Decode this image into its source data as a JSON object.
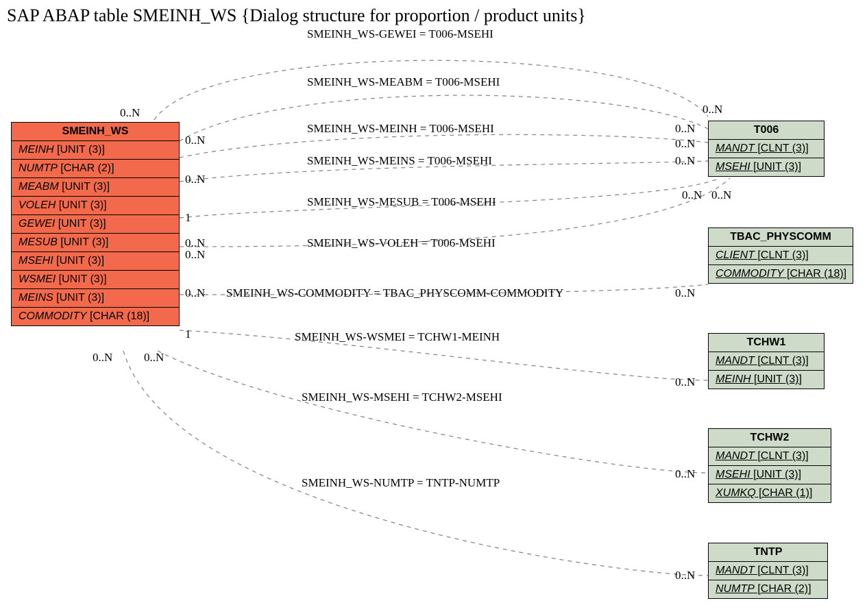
{
  "title": "SAP ABAP table SMEINH_WS {Dialog structure for proportion / product units}",
  "entities": {
    "smeinh_ws": {
      "name": "SMEINH_WS",
      "rows": [
        {
          "f": "MEINH",
          "t": " [UNIT (3)]"
        },
        {
          "f": "NUMTP",
          "t": " [CHAR (2)]"
        },
        {
          "f": "MEABM",
          "t": " [UNIT (3)]"
        },
        {
          "f": "VOLEH",
          "t": " [UNIT (3)]"
        },
        {
          "f": "GEWEI",
          "t": " [UNIT (3)]"
        },
        {
          "f": "MESUB",
          "t": " [UNIT (3)]"
        },
        {
          "f": "MSEHI",
          "t": " [UNIT (3)]"
        },
        {
          "f": "WSMEI",
          "t": " [UNIT (3)]"
        },
        {
          "f": "MEINS",
          "t": " [UNIT (3)]"
        },
        {
          "f": "COMMODITY",
          "t": " [CHAR (18)]"
        }
      ]
    },
    "t006": {
      "name": "T006",
      "rows": [
        {
          "f": "MANDT",
          "t": " [CLNT (3)]",
          "ul": true
        },
        {
          "f": "MSEHI",
          "t": " [UNIT (3)]",
          "ul": true
        }
      ]
    },
    "tbac": {
      "name": "TBAC_PHYSCOMM",
      "rows": [
        {
          "f": "CLIENT",
          "t": " [CLNT (3)]",
          "ul": true
        },
        {
          "f": "COMMODITY",
          "t": " [CHAR (18)]",
          "ul": true
        }
      ]
    },
    "tchw1": {
      "name": "TCHW1",
      "rows": [
        {
          "f": "MANDT",
          "t": " [CLNT (3)]",
          "ul": true
        },
        {
          "f": "MEINH",
          "t": " [UNIT (3)]",
          "ul": true
        }
      ]
    },
    "tchw2": {
      "name": "TCHW2",
      "rows": [
        {
          "f": "MANDT",
          "t": " [CLNT (3)]",
          "ul": true
        },
        {
          "f": "MSEHI",
          "t": " [UNIT (3)]",
          "ul": true
        },
        {
          "f": "XUMKQ",
          "t": " [CHAR (1)]",
          "ul": true
        }
      ]
    },
    "tntp": {
      "name": "TNTP",
      "rows": [
        {
          "f": "MANDT",
          "t": " [CLNT (3)]",
          "ul": true
        },
        {
          "f": "NUMTP",
          "t": " [CHAR (2)]",
          "ul": true
        }
      ]
    }
  },
  "rel_labels": {
    "r1": "SMEINH_WS-GEWEI = T006-MSEHI",
    "r2": "SMEINH_WS-MEABM = T006-MSEHI",
    "r3": "SMEINH_WS-MEINH = T006-MSEHI",
    "r4": "SMEINH_WS-MEINS = T006-MSEHI",
    "r5": "SMEINH_WS-MESUB = T006-MSEHI",
    "r6": "SMEINH_WS-VOLEH = T006-MSEHI",
    "r7": "SMEINH_WS-COMMODITY = TBAC_PHYSCOMM-COMMODITY",
    "r8": "SMEINH_WS-WSMEI = TCHW1-MEINH",
    "r9": "SMEINH_WS-MSEHI = TCHW2-MSEHI",
    "r10": "SMEINH_WS-NUMTP = TNTP-NUMTP"
  },
  "card": {
    "zn": "0..N",
    "one": "1"
  }
}
